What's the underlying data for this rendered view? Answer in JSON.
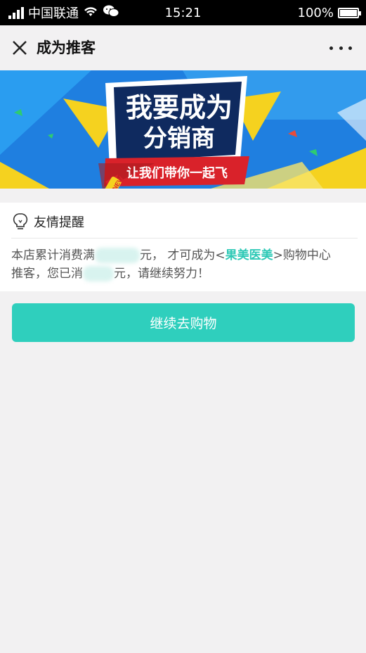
{
  "status_bar": {
    "carrier": "中国联通",
    "time": "15:21",
    "battery": "100%"
  },
  "navbar": {
    "title": "成为推客"
  },
  "banner": {
    "badge": "NEW",
    "headline_line1": "我要成为",
    "headline_line2": "分销商",
    "ribbon": "让我们带你一起飞"
  },
  "notice": {
    "title": "友情提醒",
    "text_1": "本店累计消费满",
    "text_2": "元， 才可成为<",
    "brand": "果美医美",
    "text_3": ">购物中心",
    "text_4": "推客，您已消",
    "text_5": "元，请继续努力！"
  },
  "actions": {
    "continue_shopping": "继续去购物"
  },
  "colors": {
    "accent": "#2fcfbd",
    "brand_text": "#2ec9b6",
    "banner_blue": "#1f7fe0",
    "banner_yellow": "#f5d21f"
  }
}
